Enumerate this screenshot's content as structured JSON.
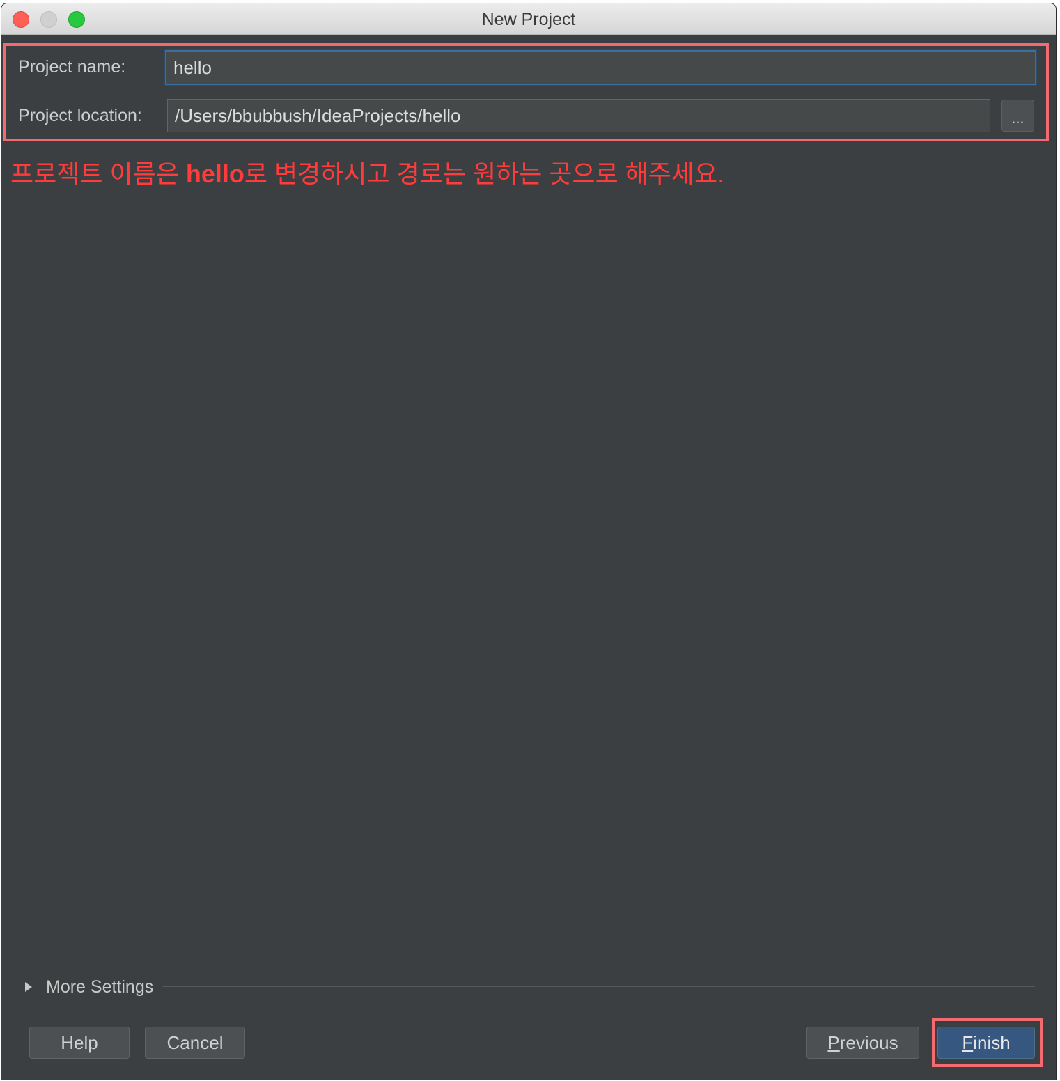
{
  "window": {
    "title": "New Project"
  },
  "form": {
    "name_label": "Project name:",
    "name_value": "hello",
    "location_label": "Project location:",
    "location_value": "/Users/bbubbush/IdeaProjects/hello",
    "browse_label": "..."
  },
  "annotation": {
    "before": "프로젝트 이름은 ",
    "emphasis": "hello",
    "after": "로 변경하시고 경로는 원하는 곳으로 해주세요.",
    "color": "#ff3b3b"
  },
  "more_settings": {
    "label": "More Settings"
  },
  "buttons": {
    "help": "Help",
    "cancel": "Cancel",
    "previous_mnemonic": "P",
    "previous_rest": "revious",
    "finish_mnemonic": "F",
    "finish_rest": "inish"
  },
  "colors": {
    "background": "#3c3f41",
    "highlight": "#f26b70",
    "primary_button": "#365880"
  }
}
